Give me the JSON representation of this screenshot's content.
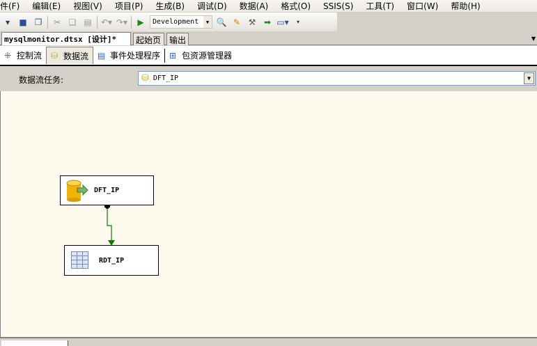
{
  "menu": [
    "件(F)",
    "编辑(E)",
    "视图(V)",
    "项目(P)",
    "生成(B)",
    "调试(D)",
    "数据(A)",
    "格式(O)",
    "SSIS(S)",
    "工具(T)",
    "窗口(W)",
    "帮助(H)"
  ],
  "toolbar": {
    "configuration": "Development"
  },
  "doc_tabs": [
    "mysqlmonitor.dtsx [设计]*",
    "起始页",
    "输出"
  ],
  "designer_tabs": [
    "控制流",
    "数据流",
    "事件处理程序",
    "包资源管理器"
  ],
  "task": {
    "label": "数据流任务:",
    "value": "DFT_IP"
  },
  "nodes": {
    "source": "DFT_IP",
    "dest": "RDT_IP"
  },
  "colors": {
    "canvas": "#fffaee",
    "path": "#008000"
  }
}
